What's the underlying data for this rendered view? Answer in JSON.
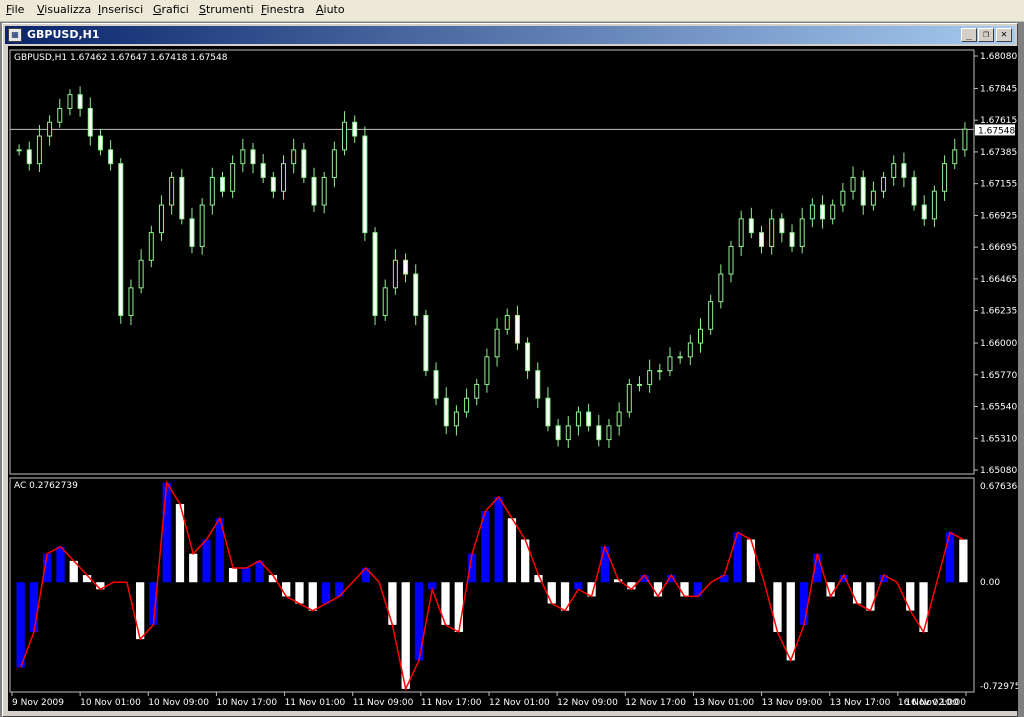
{
  "menu": [
    {
      "label": "File",
      "ul": "F",
      "rest": "ile"
    },
    {
      "label": "Visualizza",
      "ul": "V",
      "rest": "isualizza"
    },
    {
      "label": "Inserisci",
      "ul": "I",
      "rest": "nserisci"
    },
    {
      "label": "Grafici",
      "ul": "G",
      "rest": "rafici"
    },
    {
      "label": "Strumenti",
      "ul": "S",
      "rest": "trumenti"
    },
    {
      "label": "Finestra",
      "ul": "F",
      "rest": "inestra"
    },
    {
      "label": "Aiuto",
      "ul": "A",
      "rest": "iuto"
    }
  ],
  "window": {
    "title": "GBPUSD,H1",
    "minimize": "_",
    "restore": "❐",
    "close": "✕"
  },
  "chart": {
    "header": "GBPUSD,H1  1.67462 1.67647 1.67418 1.67548",
    "price_ticks": [
      "1.68080",
      "1.67845",
      "1.67615",
      "1.67385",
      "1.67155",
      "1.66925",
      "1.66695",
      "1.66465",
      "1.66235",
      "1.66000",
      "1.65770",
      "1.65540",
      "1.65310",
      "1.65080"
    ],
    "current_price": "1.67548",
    "indicator_label": "AC 0.2762739",
    "indicator_ticks": [
      "0.676368",
      "0.00",
      "-0.72975"
    ],
    "time_labels": [
      "9 Nov 2009",
      "10 Nov 01:00",
      "10 Nov 09:00",
      "10 Nov 17:00",
      "11 Nov 01:00",
      "11 Nov 09:00",
      "11 Nov 17:00",
      "12 Nov 01:00",
      "12 Nov 09:00",
      "12 Nov 17:00",
      "13 Nov 01:00",
      "13 Nov 09:00",
      "13 Nov 17:00",
      "16 Nov 02:00",
      "16 Nov 10:00"
    ],
    "colors": {
      "bull": "#90ee90",
      "bear": "#ffffff",
      "ac_up": "#0000ff",
      "ac_down": "#ffffff",
      "ac_line": "#ff0000",
      "grid": "#c0c0c0"
    }
  },
  "chart_data": {
    "type": "line",
    "price_close_estimates": [
      1.674,
      1.673,
      1.675,
      1.676,
      1.677,
      1.678,
      1.677,
      1.675,
      1.674,
      1.673,
      1.662,
      1.664,
      1.666,
      1.668,
      1.67,
      1.672,
      1.669,
      1.667,
      1.67,
      1.672,
      1.671,
      1.673,
      1.674,
      1.673,
      1.672,
      1.671,
      1.673,
      1.674,
      1.672,
      1.67,
      1.672,
      1.674,
      1.676,
      1.675,
      1.668,
      1.662,
      1.664,
      1.666,
      1.665,
      1.662,
      1.658,
      1.656,
      1.654,
      1.655,
      1.656,
      1.657,
      1.659,
      1.661,
      1.662,
      1.66,
      1.658,
      1.656,
      1.654,
      1.653,
      1.654,
      1.655,
      1.654,
      1.653,
      1.654,
      1.655,
      1.657,
      1.657,
      1.658,
      1.658,
      1.659,
      1.659,
      1.66,
      1.661,
      1.663,
      1.665,
      1.667,
      1.669,
      1.668,
      1.667,
      1.669,
      1.668,
      1.667,
      1.669,
      1.67,
      1.669,
      1.67,
      1.671,
      1.672,
      1.67,
      1.671,
      1.672,
      1.673,
      1.672,
      1.67,
      1.669,
      1.671,
      1.673,
      1.674,
      1.6755
    ],
    "ac_values": [
      -0.6,
      -0.35,
      0.2,
      0.25,
      0.15,
      0.05,
      -0.05,
      0.0,
      0.0,
      -0.4,
      -0.3,
      0.7,
      0.55,
      0.2,
      0.3,
      0.45,
      0.1,
      0.1,
      0.15,
      0.05,
      -0.1,
      -0.15,
      -0.2,
      -0.15,
      -0.1,
      0.0,
      0.1,
      0.0,
      -0.3,
      -0.75,
      -0.55,
      -0.05,
      -0.3,
      -0.35,
      0.2,
      0.5,
      0.6,
      0.45,
      0.3,
      0.05,
      -0.15,
      -0.2,
      -0.05,
      -0.1,
      0.25,
      0.02,
      -0.05,
      0.05,
      -0.1,
      0.05,
      -0.1,
      -0.1,
      0.0,
      0.05,
      0.35,
      0.3,
      0.0,
      -0.35,
      -0.55,
      -0.3,
      0.2,
      -0.1,
      0.05,
      -0.15,
      -0.2,
      0.05,
      0.0,
      -0.2,
      -0.35,
      0.0,
      0.35,
      0.3
    ]
  }
}
